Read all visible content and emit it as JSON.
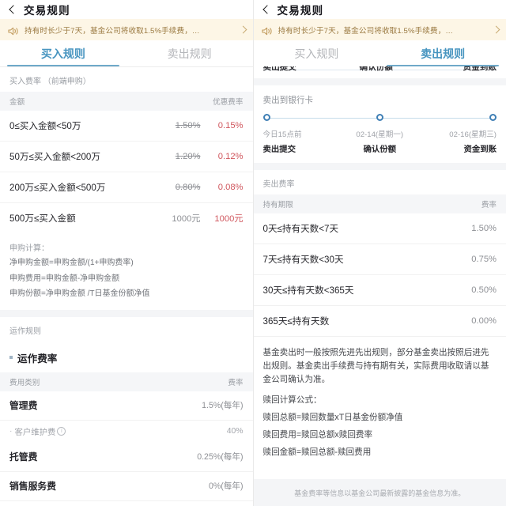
{
  "nav": {
    "title": "交易规则",
    "back_icon": "chevron-left-icon"
  },
  "notice": {
    "icon": "speaker-icon",
    "text": "持有时长少于7天，基金公司将收取1.5%手续费，…",
    "chevron": "chevron-right-icon",
    "bg": "#fdf6e6",
    "color": "#9b7a42"
  },
  "tabs": {
    "buy_label": "买入规则",
    "sell_label": "卖出规则",
    "active_color": "#4895c0",
    "inactive_color": "#b4b6ba",
    "left_active": "买入规则",
    "right_active": "卖出规则"
  },
  "left": {
    "section_label": "买入费率 （前端申购）",
    "table": {
      "col_amount": "金额",
      "col_rate": "优惠费率",
      "rows": [
        {
          "range": "0≤买入金额<50万",
          "original": "1.50%",
          "discount": "0.15%"
        },
        {
          "range": "50万≤买入金额<200万",
          "original": "1.20%",
          "discount": "0.12%"
        },
        {
          "range": "200万≤买入金额<500万",
          "original": "0.80%",
          "discount": "0.08%"
        },
        {
          "range": "500万≤买入金额",
          "original": "1000元",
          "discount": "1000元"
        }
      ]
    },
    "calc": {
      "title": "申购计算：",
      "lines": [
        "净申购金额=申购金额/(1+申购费率)",
        "申购费用=申购金额-净申购金额",
        "申购份额=净申购金额 /T日基金份额净值"
      ]
    },
    "operating": {
      "section_label": "运作规则",
      "heading": "运作费率",
      "col_type": "费用类别",
      "col_rate": "费率",
      "rows": [
        {
          "name": "管理费",
          "value": "1.5%(每年)",
          "sub": false
        },
        {
          "name": "客户维护费",
          "value": "40%",
          "sub": true
        },
        {
          "name": "托管费",
          "value": "0.25%(每年)",
          "sub": false
        },
        {
          "name": "销售服务费",
          "value": "0%(每年)",
          "sub": false
        }
      ]
    }
  },
  "right": {
    "clipped_steps": [
      "卖出提交",
      "确认份额",
      "资金到账"
    ],
    "timeline": {
      "title": "卖出到银行卡",
      "steps": [
        {
          "date": "今日15点前",
          "step": "卖出提交"
        },
        {
          "date": "02-14(星期一)",
          "step": "确认份额"
        },
        {
          "date": "02-16(星期三)",
          "step": "资金到账"
        }
      ],
      "dot_color": "#3f7fb5",
      "line_color": "#c6dcea"
    },
    "sell_table": {
      "section_label": "卖出费率",
      "col_term": "持有期限",
      "col_rate": "费率",
      "rows": [
        {
          "term": "0天≤持有天数<7天",
          "rate": "1.50%"
        },
        {
          "term": "7天≤持有天数<30天",
          "rate": "0.75%"
        },
        {
          "term": "30天≤持有天数<365天",
          "rate": "0.50%"
        },
        {
          "term": "365天≤持有天数",
          "rate": "0.00%"
        }
      ]
    },
    "note": {
      "paragraph": "基金卖出时一般按照先进先出规则，部分基金卖出按照后进先出规则。基金卖出手续费与持有期有关，实际费用收取请以基金公司确认为准。",
      "formula_title": "赎回计算公式：",
      "formulas": [
        "赎回总额=赎回数量xT日基金份额净值",
        "赎回费用=赎回总额x赎回费率",
        "赎回金额=赎回总额-赎回费用"
      ]
    },
    "footer": "基金费率等信息以基金公司最新披露的基金信息为准。"
  }
}
